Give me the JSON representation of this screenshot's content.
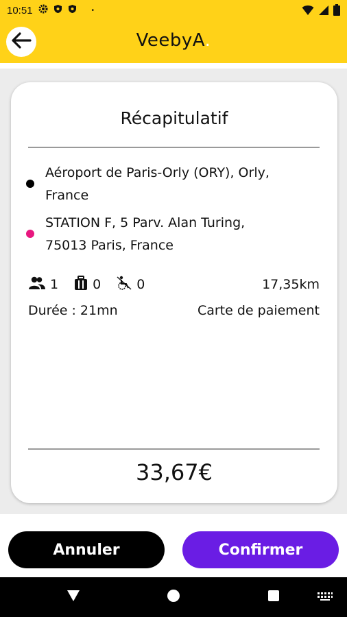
{
  "status_bar": {
    "time": "10:51",
    "dot": "•",
    "left_icons": [
      "gear-icon",
      "shield-icon",
      "shield-icon"
    ],
    "right_icons": [
      "wifi-icon",
      "signal-icon",
      "battery-icon"
    ]
  },
  "app_bar": {
    "logo_text": "VeebyA",
    "logo_dot": ".",
    "back_icon": "arrow-left-icon",
    "brand_color": "#ffd218"
  },
  "summary": {
    "title": "Récapitulatif",
    "pickup": {
      "line1": "Aéroport de Paris-Orly (ORY), Orly,",
      "line2": "France",
      "dot_color": "#000000"
    },
    "dropoff": {
      "line1": "STATION F, 5 Parv. Alan Turing,",
      "line2": "75013 Paris, France",
      "dot_color": "#e8177f"
    },
    "passengers": "1",
    "luggage": "0",
    "wheelchair": "0",
    "distance": "17,35km",
    "duration": "Durée : 21mn",
    "payment": "Carte de paiement",
    "price": "33,67€"
  },
  "actions": {
    "cancel_label": "Annuler",
    "confirm_label": "Confirmer",
    "confirm_color": "#6a1de4"
  },
  "nav_bar": {
    "icons": [
      "back-triangle-icon",
      "home-circle-icon",
      "recents-square-icon",
      "keyboard-icon"
    ]
  }
}
